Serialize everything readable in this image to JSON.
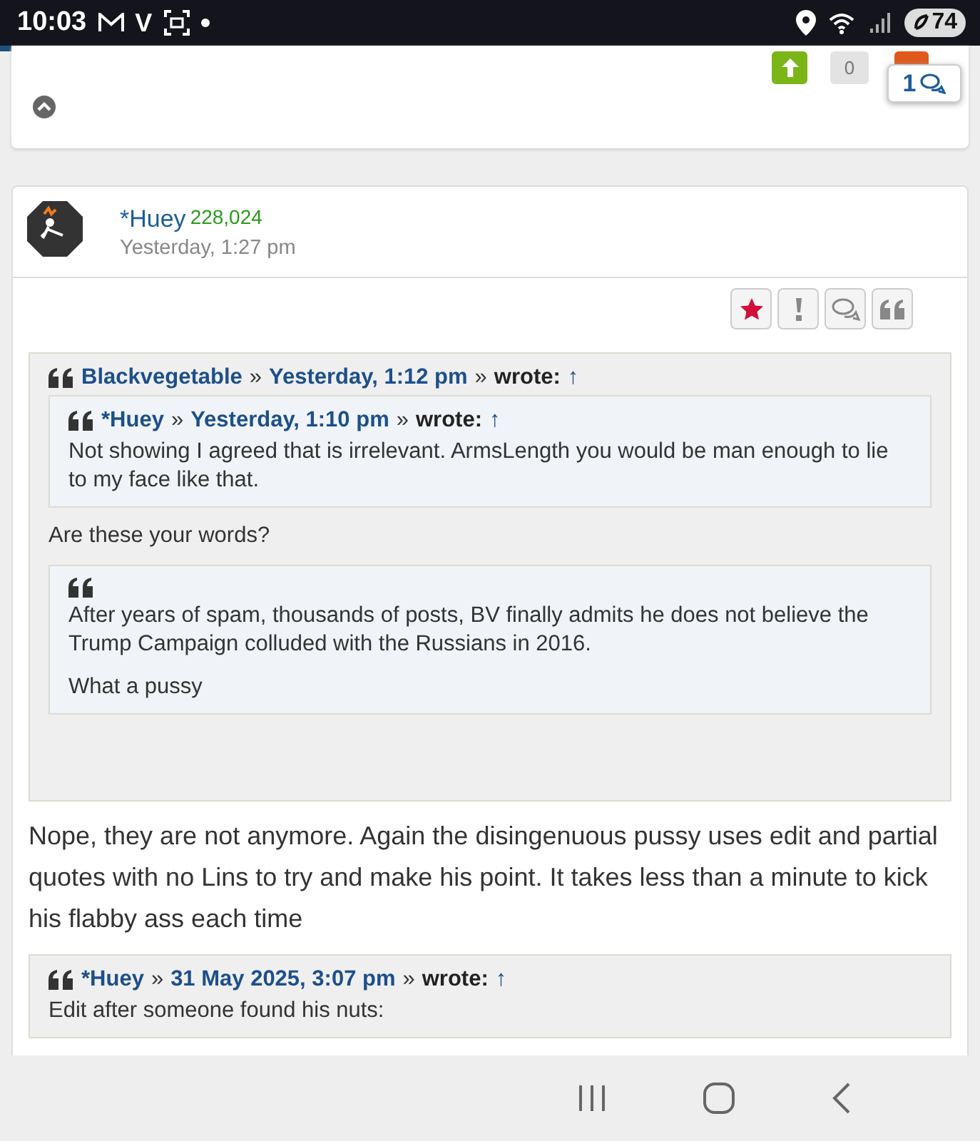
{
  "status_bar": {
    "time": "10:03",
    "app_letter": "V",
    "battery": "74"
  },
  "page_load": {
    "level": 0.15
  },
  "top_card": {
    "vote_count": "0",
    "comment_count": "1"
  },
  "post": {
    "author": "*Huey",
    "score": "228,024",
    "time": "Yesterday, 1:27 pm",
    "actions": [
      {
        "kind": "star",
        "selected": true
      },
      {
        "kind": "report",
        "selected": false
      },
      {
        "kind": "reply",
        "selected": false
      },
      {
        "kind": "quote",
        "selected": false
      }
    ],
    "body": [
      {
        "kind": "quote",
        "author": "Blackvegetable",
        "separator": "»",
        "time": "Yesterday, 1:12 pm",
        "separator_2": "»",
        "wrote": "wrote:",
        "arrow": "↑",
        "content": [
          {
            "kind": "quote",
            "author": "*Huey",
            "separator": "»",
            "time": "Yesterday, 1:10 pm",
            "separator_2": "»",
            "wrote": "wrote:",
            "arrow": "↑",
            "content": [
              {
                "kind": "text",
                "text": "Not showing I agreed that is irrelevant.  ArmsLength you would be man enough to lie to my face like that."
              }
            ]
          },
          {
            "kind": "text",
            "text": "Are these your words?"
          },
          {
            "kind": "quote",
            "content": [
              {
                "kind": "text",
                "text": "After years of spam, thousands of posts, BV finally admits he does not believe the Trump Campaign colluded with the Russians in 2016."
              },
              {
                "kind": "text",
                "text": "What a pussy"
              }
            ]
          }
        ]
      },
      {
        "kind": "reply",
        "text": "Nope, they are not anymore.  Again the disingenuous pussy uses edit and partial quotes with no Lins to try and make his point.  It takes less than a minute to kick his flabby ass each time"
      },
      {
        "kind": "quote",
        "author": "*Huey",
        "separator": "»",
        "time": "31 May 2025, 3:07 pm",
        "separator_2": "»",
        "wrote": "wrote:",
        "arrow": "↑",
        "content": [
          {
            "kind": "text",
            "text": "Edit after someone found his nuts:"
          }
        ]
      }
    ]
  }
}
